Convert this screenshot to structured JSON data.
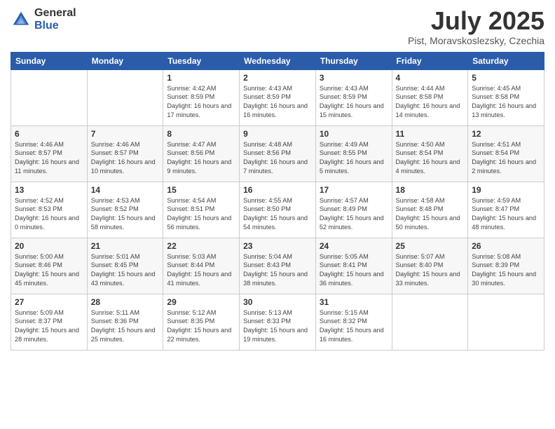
{
  "logo": {
    "general": "General",
    "blue": "Blue"
  },
  "header": {
    "title": "July 2025",
    "subtitle": "Pist, Moravskoslezsky, Czechia"
  },
  "weekdays": [
    "Sunday",
    "Monday",
    "Tuesday",
    "Wednesday",
    "Thursday",
    "Friday",
    "Saturday"
  ],
  "weeks": [
    [
      {
        "day": "",
        "info": ""
      },
      {
        "day": "",
        "info": ""
      },
      {
        "day": "1",
        "info": "Sunrise: 4:42 AM\nSunset: 8:59 PM\nDaylight: 16 hours and 17 minutes."
      },
      {
        "day": "2",
        "info": "Sunrise: 4:43 AM\nSunset: 8:59 PM\nDaylight: 16 hours and 16 minutes."
      },
      {
        "day": "3",
        "info": "Sunrise: 4:43 AM\nSunset: 8:59 PM\nDaylight: 16 hours and 15 minutes."
      },
      {
        "day": "4",
        "info": "Sunrise: 4:44 AM\nSunset: 8:58 PM\nDaylight: 16 hours and 14 minutes."
      },
      {
        "day": "5",
        "info": "Sunrise: 4:45 AM\nSunset: 8:58 PM\nDaylight: 16 hours and 13 minutes."
      }
    ],
    [
      {
        "day": "6",
        "info": "Sunrise: 4:46 AM\nSunset: 8:57 PM\nDaylight: 16 hours and 11 minutes."
      },
      {
        "day": "7",
        "info": "Sunrise: 4:46 AM\nSunset: 8:57 PM\nDaylight: 16 hours and 10 minutes."
      },
      {
        "day": "8",
        "info": "Sunrise: 4:47 AM\nSunset: 8:56 PM\nDaylight: 16 hours and 9 minutes."
      },
      {
        "day": "9",
        "info": "Sunrise: 4:48 AM\nSunset: 8:56 PM\nDaylight: 16 hours and 7 minutes."
      },
      {
        "day": "10",
        "info": "Sunrise: 4:49 AM\nSunset: 8:55 PM\nDaylight: 16 hours and 5 minutes."
      },
      {
        "day": "11",
        "info": "Sunrise: 4:50 AM\nSunset: 8:54 PM\nDaylight: 16 hours and 4 minutes."
      },
      {
        "day": "12",
        "info": "Sunrise: 4:51 AM\nSunset: 8:54 PM\nDaylight: 16 hours and 2 minutes."
      }
    ],
    [
      {
        "day": "13",
        "info": "Sunrise: 4:52 AM\nSunset: 8:53 PM\nDaylight: 16 hours and 0 minutes."
      },
      {
        "day": "14",
        "info": "Sunrise: 4:53 AM\nSunset: 8:52 PM\nDaylight: 15 hours and 58 minutes."
      },
      {
        "day": "15",
        "info": "Sunrise: 4:54 AM\nSunset: 8:51 PM\nDaylight: 15 hours and 56 minutes."
      },
      {
        "day": "16",
        "info": "Sunrise: 4:55 AM\nSunset: 8:50 PM\nDaylight: 15 hours and 54 minutes."
      },
      {
        "day": "17",
        "info": "Sunrise: 4:57 AM\nSunset: 8:49 PM\nDaylight: 15 hours and 52 minutes."
      },
      {
        "day": "18",
        "info": "Sunrise: 4:58 AM\nSunset: 8:48 PM\nDaylight: 15 hours and 50 minutes."
      },
      {
        "day": "19",
        "info": "Sunrise: 4:59 AM\nSunset: 8:47 PM\nDaylight: 15 hours and 48 minutes."
      }
    ],
    [
      {
        "day": "20",
        "info": "Sunrise: 5:00 AM\nSunset: 8:46 PM\nDaylight: 15 hours and 45 minutes."
      },
      {
        "day": "21",
        "info": "Sunrise: 5:01 AM\nSunset: 8:45 PM\nDaylight: 15 hours and 43 minutes."
      },
      {
        "day": "22",
        "info": "Sunrise: 5:03 AM\nSunset: 8:44 PM\nDaylight: 15 hours and 41 minutes."
      },
      {
        "day": "23",
        "info": "Sunrise: 5:04 AM\nSunset: 8:43 PM\nDaylight: 15 hours and 38 minutes."
      },
      {
        "day": "24",
        "info": "Sunrise: 5:05 AM\nSunset: 8:41 PM\nDaylight: 15 hours and 36 minutes."
      },
      {
        "day": "25",
        "info": "Sunrise: 5:07 AM\nSunset: 8:40 PM\nDaylight: 15 hours and 33 minutes."
      },
      {
        "day": "26",
        "info": "Sunrise: 5:08 AM\nSunset: 8:39 PM\nDaylight: 15 hours and 30 minutes."
      }
    ],
    [
      {
        "day": "27",
        "info": "Sunrise: 5:09 AM\nSunset: 8:37 PM\nDaylight: 15 hours and 28 minutes."
      },
      {
        "day": "28",
        "info": "Sunrise: 5:11 AM\nSunset: 8:36 PM\nDaylight: 15 hours and 25 minutes."
      },
      {
        "day": "29",
        "info": "Sunrise: 5:12 AM\nSunset: 8:35 PM\nDaylight: 15 hours and 22 minutes."
      },
      {
        "day": "30",
        "info": "Sunrise: 5:13 AM\nSunset: 8:33 PM\nDaylight: 15 hours and 19 minutes."
      },
      {
        "day": "31",
        "info": "Sunrise: 5:15 AM\nSunset: 8:32 PM\nDaylight: 15 hours and 16 minutes."
      },
      {
        "day": "",
        "info": ""
      },
      {
        "day": "",
        "info": ""
      }
    ]
  ]
}
